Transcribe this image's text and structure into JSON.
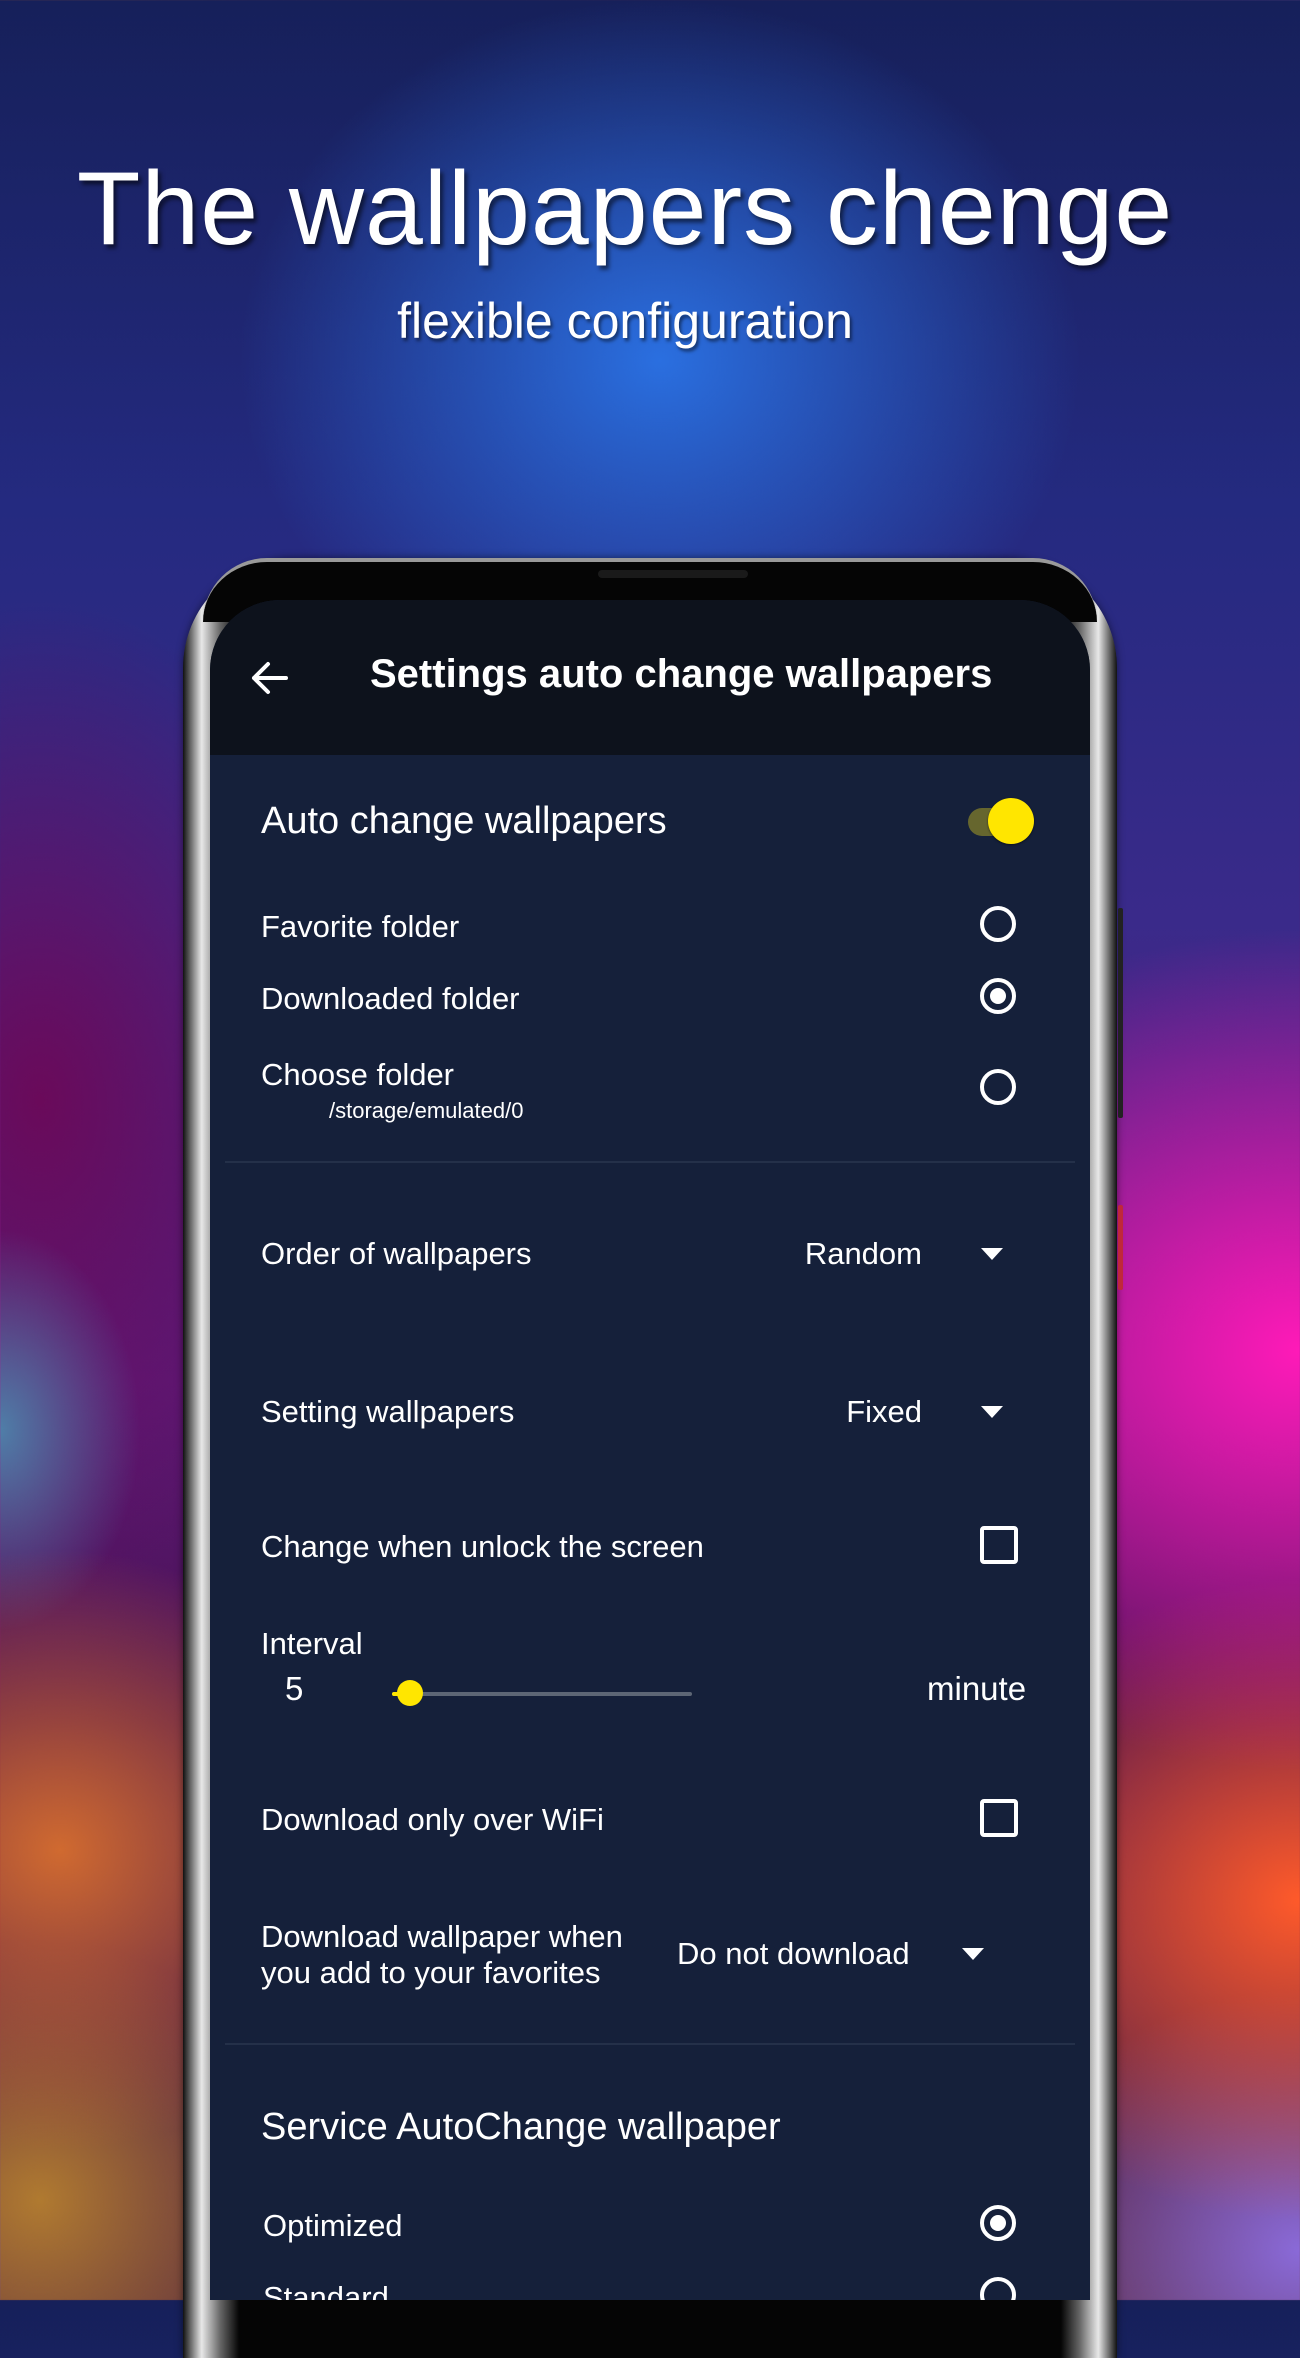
{
  "promo": {
    "headline": "The wallpapers chenge",
    "subline": "flexible configuration"
  },
  "appbar": {
    "back_icon": "arrow-left-icon",
    "title": "Settings auto change wallpapers"
  },
  "auto_change": {
    "label": "Auto change wallpapers",
    "enabled": true,
    "accent_color": "#ffe600"
  },
  "folders": {
    "options": [
      {
        "label": "Favorite folder",
        "checked": false
      },
      {
        "label": "Downloaded folder",
        "checked": true
      },
      {
        "label": "Choose folder",
        "sublabel": "/storage/emulated/0",
        "checked": false
      }
    ]
  },
  "order": {
    "label": "Order of wallpapers",
    "value": "Random"
  },
  "setting_wallpapers": {
    "label": "Setting wallpapers",
    "value": "Fixed"
  },
  "unlock": {
    "label": "Change when unlock the screen",
    "checked": false
  },
  "interval": {
    "label": "Interval",
    "value": "5",
    "unit": "minute",
    "slider_fraction": 0.06
  },
  "wifi": {
    "label": "Download only over WiFi",
    "checked": false
  },
  "download_fav": {
    "label_line1": "Download wallpaper when",
    "label_line2": "you add to your favorites",
    "value": "Do not download"
  },
  "service": {
    "title": "Service AutoChange wallpaper",
    "options": [
      {
        "label": "Optimized",
        "checked": true
      },
      {
        "label": "Standard",
        "checked": false
      }
    ]
  }
}
